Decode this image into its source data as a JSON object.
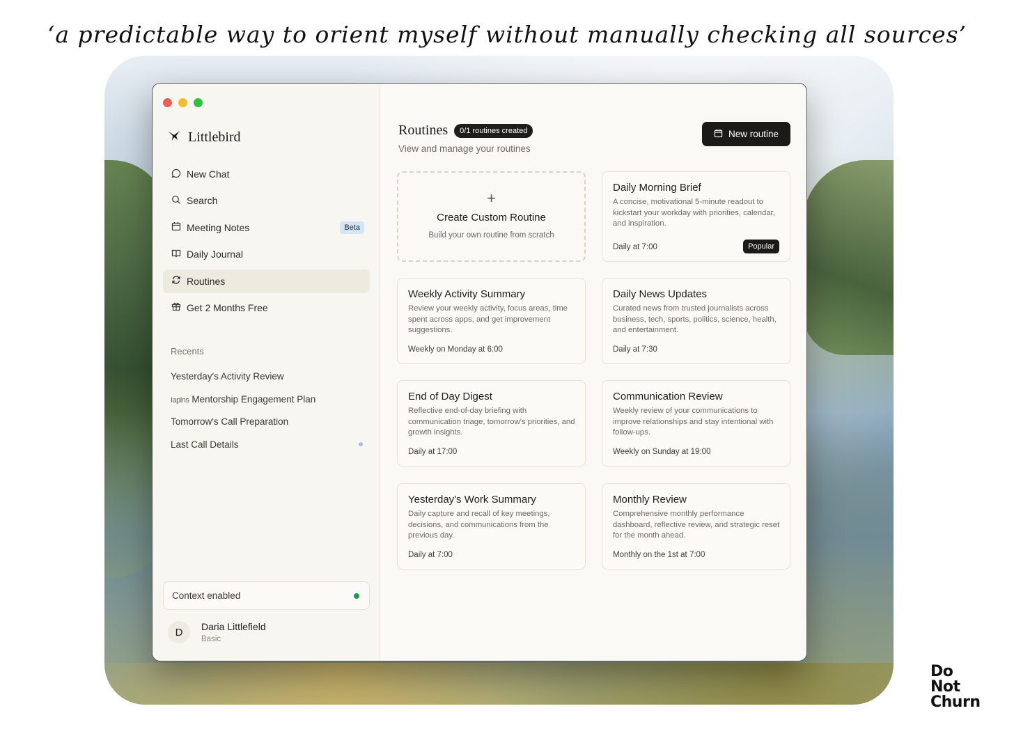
{
  "caption": "‘a predictable way to orient myself without manually checking all sources’",
  "brand": {
    "name": "Littlebird",
    "logo_icon": "bird-icon"
  },
  "nav": [
    {
      "label": "New Chat",
      "icon": "chat-bubble-icon",
      "active": false
    },
    {
      "label": "Search",
      "icon": "search-icon",
      "active": false
    },
    {
      "label": "Meeting Notes",
      "icon": "calendar-icon",
      "badge": "Beta",
      "active": false
    },
    {
      "label": "Daily Journal",
      "icon": "book-icon",
      "active": false
    },
    {
      "label": "Routines",
      "icon": "refresh-icon",
      "active": true
    },
    {
      "label": "Get 2 Months Free",
      "icon": "gift-icon",
      "active": false
    }
  ],
  "recents": {
    "title": "Recents",
    "items": [
      {
        "label": "Yesterday's Activity Review",
        "unread": false
      },
      {
        "label": "Mentorship Engagement Plan",
        "prefix": "Iaplns",
        "unread": false
      },
      {
        "label": "Tomorrow's Call Preparation",
        "unread": false
      },
      {
        "label": "Last Call Details",
        "unread": true
      }
    ]
  },
  "context": {
    "label": "Context enabled",
    "status_color": "#1e9c4b"
  },
  "profile": {
    "initial": "D",
    "name": "Daria Littlefield",
    "plan": "Basic"
  },
  "main": {
    "title": "Routines",
    "count_badge": "0/1 routines created",
    "subtitle": "View and manage your routines",
    "new_button": "New routine",
    "create_card": {
      "icon": "+",
      "title": "Create Custom Routine",
      "desc": "Build your own routine from scratch"
    },
    "routines": [
      {
        "title": "Daily Morning Brief",
        "desc": "A concise, motivational 5-minute readout to kickstart your workday with priorities, calendar, and inspiration.",
        "schedule": "Daily at 7:00",
        "badge": "Popular"
      },
      {
        "title": "Weekly Activity Summary",
        "desc": "Review your weekly activity, focus areas, time spent across apps, and get improvement suggestions.",
        "schedule": "Weekly on Monday at 6:00"
      },
      {
        "title": "Daily News Updates",
        "desc": "Curated news from trusted journalists across business, tech, sports, politics, science, health, and entertainment.",
        "schedule": "Daily at 7:30"
      },
      {
        "title": "End of Day Digest",
        "desc": "Reflective end-of-day briefing with communication triage, tomorrow's priorities, and growth insights.",
        "schedule": "Daily at 17:00"
      },
      {
        "title": "Communication Review",
        "desc": "Weekly review of your communications to improve relationships and stay intentional with follow-ups.",
        "schedule": "Weekly on Sunday at 19:00"
      },
      {
        "title": "Yesterday's Work Summary",
        "desc": "Daily capture and recall of key meetings, decisions, and communications from the previous day.",
        "schedule": "Daily at 7:00"
      },
      {
        "title": "Monthly Review",
        "desc": "Comprehensive monthly performance dashboard, reflective review, and strategic reset for the month ahead.",
        "schedule": "Monthly on the 1st at 7:00"
      }
    ]
  },
  "watermark": {
    "line1": "Do",
    "line2": "Not",
    "line3": "Churn"
  }
}
